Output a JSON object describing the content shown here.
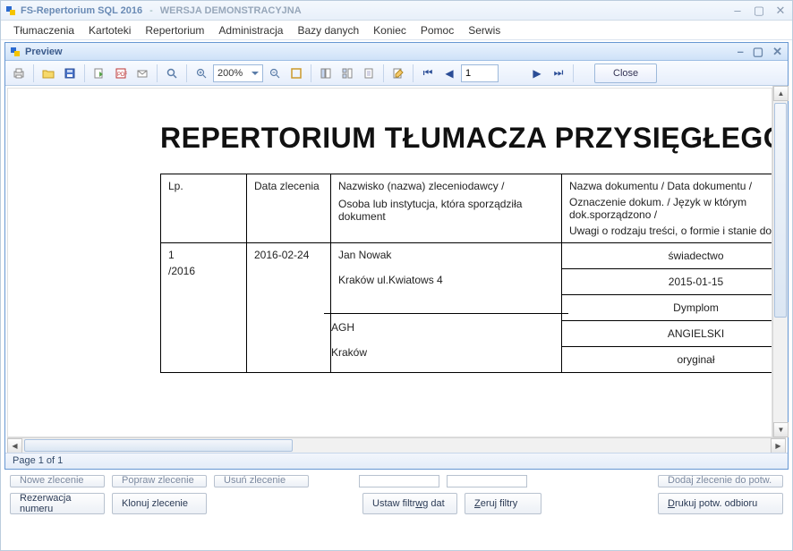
{
  "app": {
    "title": "FS-Repertorium SQL 2016",
    "subtitle": "WERSJA DEMONSTRACYJNA"
  },
  "menu": [
    "Tłumaczenia",
    "Kartoteki",
    "Repertorium",
    "Administracja",
    "Bazy danych",
    "Koniec",
    "Pomoc",
    "Serwis"
  ],
  "preview": {
    "title": "Preview",
    "zoom": "200%",
    "page_number": "1",
    "close": "Close",
    "status": "Page 1 of 1"
  },
  "doc": {
    "title": "REPERTORIUM TŁUMACZA PRZYSIĘGŁEGO",
    "headers": {
      "lp": "Lp.",
      "date": "Data zlecenia",
      "name_l1": "Nazwisko (nazwa) zleceniodawcy /",
      "name_l2": "Osoba lub instytucja, która sporządziła dokument",
      "doc_l1": "Nazwa dokumentu / Data dokumentu /",
      "doc_l2": "Oznaczenie dokum. / Język w którym dok.sporządzono /",
      "doc_l3": "Uwagi o rodzaju treści, o formie i stanie dokumentu"
    },
    "row": {
      "lp1": "1",
      "lp2": "/2016",
      "date": "2016-02-24",
      "client": "Jan Nowak",
      "client_addr": "Kraków ul.Kwiatows 4",
      "issuer": "AGH",
      "issuer_addr": "Kraków",
      "doc_name": "świadectwo",
      "doc_date": "2015-01-15",
      "doc_mark": "Dymplom",
      "doc_lang": "ANGIELSKI",
      "doc_note": "oryginał"
    }
  },
  "buttons": {
    "row1": {
      "nowe": "Nowe zlecenie",
      "popraw": "Popraw zlecenie",
      "usun": "Usuń zlecenie",
      "dodaj": "Dodaj zlecenie do potw."
    },
    "row2": {
      "rezerwacja": "Rezerwacja numeru",
      "klonuj": "Klonuj zlecenie",
      "ustaw_p": "Ustaw filtr ",
      "ustaw_u": "w",
      "ustaw_s": "g dat",
      "zeruj_u": "Z",
      "zeruj_s": "eruj filtry",
      "drukuj_u": "D",
      "drukuj_s": "rukuj potw. odbioru"
    }
  }
}
